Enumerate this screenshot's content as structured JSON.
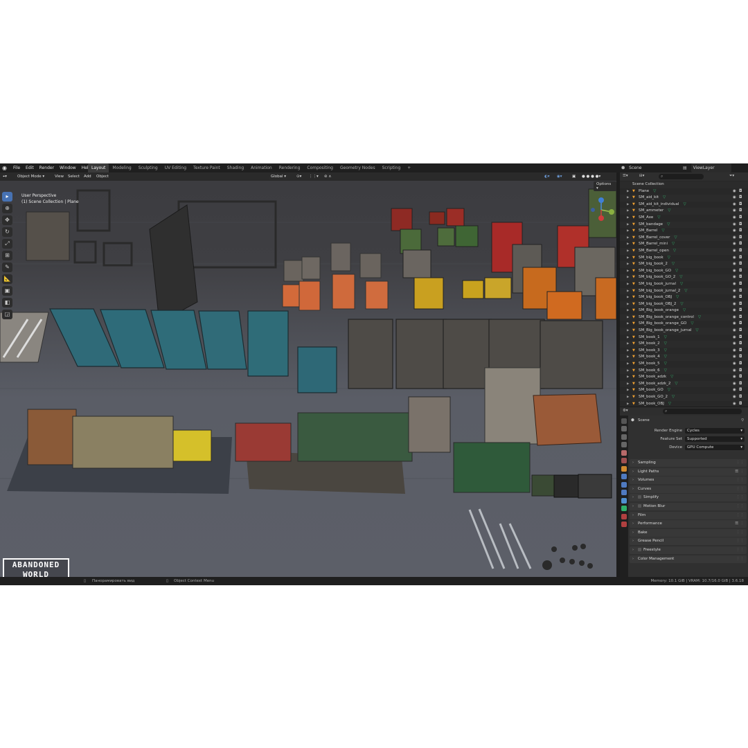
{
  "app": {
    "menus": [
      "File",
      "Edit",
      "Render",
      "Window",
      "Help"
    ],
    "workspaces": [
      "Layout",
      "Modeling",
      "Sculpting",
      "UV Editing",
      "Texture Paint",
      "Shading",
      "Animation",
      "Rendering",
      "Compositing",
      "Geometry Nodes",
      "Scripting",
      "+"
    ],
    "active_workspace": "Layout",
    "scene_name": "Scene",
    "view_layer": "ViewLayer"
  },
  "viewport_header": {
    "mode": "Object Mode",
    "menus": [
      "View",
      "Select",
      "Add",
      "Object"
    ],
    "orientation": "Global",
    "options_label": "Options"
  },
  "viewport": {
    "perspective_label": "User Perspective",
    "collection_label": "(1) Scene Collection | Plane",
    "watermark_line1": "ABANDONED",
    "watermark_line2": "WORLD"
  },
  "outliner": {
    "root": "Scene Collection",
    "items": [
      "Plane",
      "SM_aid_kit",
      "SM_aid_kit_individual",
      "SM_ammeter",
      "SM_Axe",
      "SM_bandage",
      "SM_Barrel",
      "SM_Barrel_cover",
      "SM_Barrel_mini",
      "SM_Barrel_open",
      "SM_big_book",
      "SM_big_book_2",
      "SM_big_book_GO",
      "SM_big_book_GO_2",
      "SM_big_book_jurnal",
      "SM_big_book_jurnal_2",
      "SM_big_book_OBJ",
      "SM_big_book_OBJ_2",
      "SM_Big_book_orange",
      "SM_Big_book_orange_control",
      "SM_Big_book_orange_GO",
      "SM_Big_book_orange_jurnal",
      "SM_book_1",
      "SM_book_2",
      "SM_book_3",
      "SM_book_4",
      "SM_book_5",
      "SM_book_6",
      "SM_book_adzk",
      "SM_book_adzk_2",
      "SM_book_GO",
      "SM_book_GO_2",
      "SM_book_OBJ"
    ]
  },
  "properties": {
    "context": "Scene",
    "render_engine_label": "Render Engine",
    "render_engine": "Cycles",
    "feature_set_label": "Feature Set",
    "feature_set": "Supported",
    "device_label": "Device",
    "device": "GPU Compute",
    "panels": [
      "Sampling",
      "Light Paths",
      "Volumes",
      "Curves",
      "Simplify",
      "Motion Blur",
      "Film",
      "Performance",
      "Bake",
      "Grease Pencil",
      "Freestyle",
      "Color Management"
    ]
  },
  "statusbar": {
    "left_hint": "Панорамировать вид",
    "mid_hint": "Object Context Menu",
    "stats": "Memory: 10.1 GiB | VRAM: 10.7/16.0 GiB | 3.6.18"
  },
  "colors": {
    "accent": "#4772b3",
    "object_icon": "#f0a030",
    "mesh_icon": "#2fb06a"
  }
}
